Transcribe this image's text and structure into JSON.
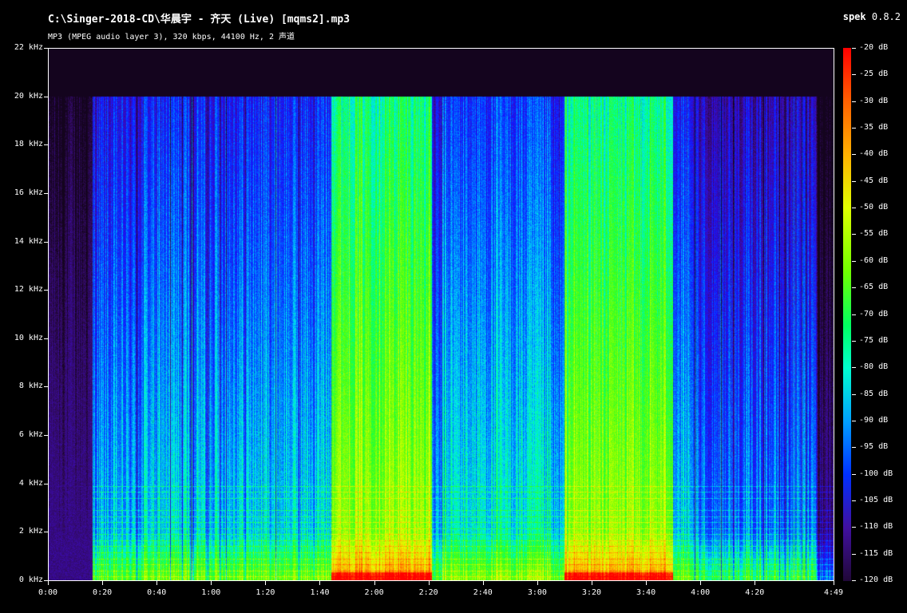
{
  "window": {
    "title": "C:\\Singer-2018-CD\\华晨宇 - 齐天 (Live) [mqms2].mp3",
    "subtitle": "MP3 (MPEG audio layer 3), 320 kbps, 44100 Hz, 2 声道",
    "app_name": "spek",
    "app_version": "0.8.2"
  },
  "spectrogram": {
    "y_axis": {
      "unit": "kHz",
      "range": [
        0,
        22
      ],
      "tick_labels": [
        "22 kHz",
        "20 kHz",
        "18 kHz",
        "16 kHz",
        "14 kHz",
        "12 kHz",
        "10 kHz",
        "8 kHz",
        "6 kHz",
        "4 kHz",
        "2 kHz",
        "0 kHz"
      ]
    },
    "x_axis": {
      "duration_seconds": 289,
      "tick_labels": [
        "0:00",
        "0:20",
        "0:40",
        "1:00",
        "1:20",
        "1:40",
        "2:00",
        "2:20",
        "2:40",
        "3:00",
        "3:20",
        "3:40",
        "4:00",
        "4:20",
        "4:49"
      ]
    },
    "colorbar": {
      "range_db": [
        -120,
        -20
      ],
      "tick_labels": [
        "-20 dB",
        "-25 dB",
        "-30 dB",
        "-35 dB",
        "-40 dB",
        "-45 dB",
        "-50 dB",
        "-55 dB",
        "-60 dB",
        "-65 dB",
        "-70 dB",
        "-75 dB",
        "-80 dB",
        "-85 dB",
        "-90 dB",
        "-95 dB",
        "-100 dB",
        "-105 dB",
        "-110 dB",
        "-115 dB",
        "-120 dB"
      ]
    },
    "lowpass_cutoff_khz": 20
  }
}
